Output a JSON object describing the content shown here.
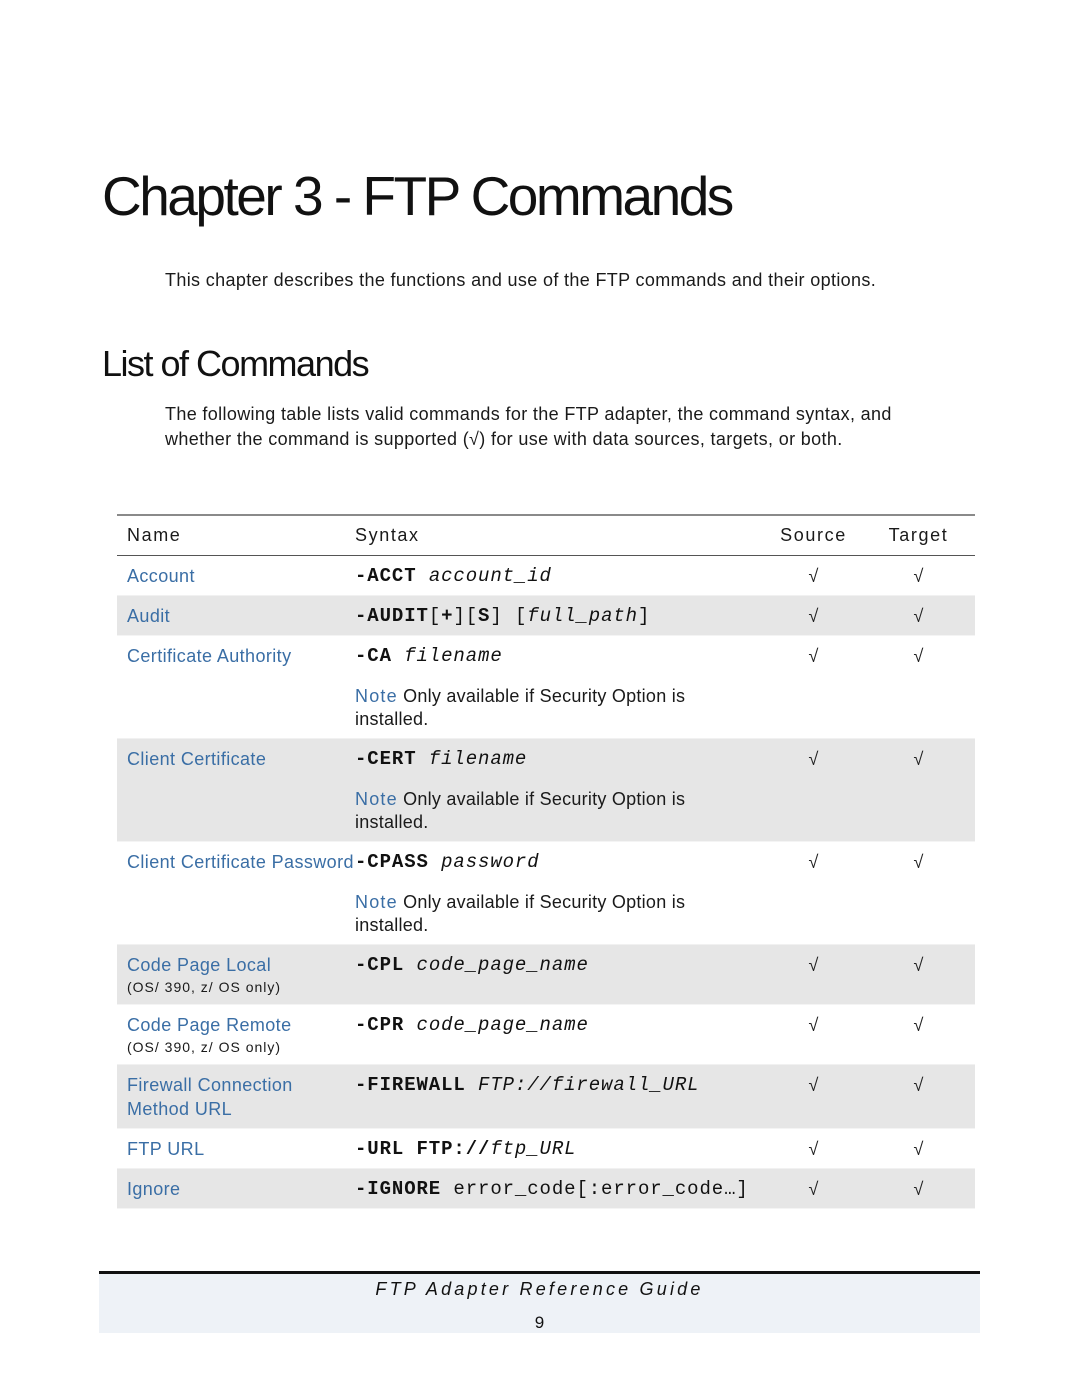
{
  "chapter_title": "Chapter 3 - FTP Commands",
  "intro": "This chapter describes the functions and use of the FTP commands and their options.",
  "section_title": "List of Commands",
  "section_intro": "The following table lists valid commands for the FTP adapter, the command syntax, and whether the command is supported (√) for use with data sources, targets, or both.",
  "table": {
    "headers": {
      "name": "Name",
      "syntax": "Syntax",
      "source": "Source",
      "target": "Target"
    },
    "rows": [
      {
        "name": "Account",
        "sub": "",
        "shaded": false,
        "syntax": [
          {
            "text": "-ACCT",
            "style": "b"
          },
          {
            "text": " account_id",
            "style": "i"
          }
        ],
        "note_label": "",
        "note": "",
        "source": "√",
        "target": "√"
      },
      {
        "name": "Audit",
        "sub": "",
        "shaded": true,
        "syntax": [
          {
            "text": "-AUDIT",
            "style": "b"
          },
          {
            "text": "[",
            "style": "n"
          },
          {
            "text": "+",
            "style": "b"
          },
          {
            "text": "][",
            "style": "n"
          },
          {
            "text": "S",
            "style": "b"
          },
          {
            "text": "] [",
            "style": "n"
          },
          {
            "text": "full_path",
            "style": "i"
          },
          {
            "text": "]",
            "style": "n"
          }
        ],
        "note_label": "",
        "note": "",
        "source": "√",
        "target": "√"
      },
      {
        "name": "Certificate Authority",
        "sub": "",
        "shaded": false,
        "syntax": [
          {
            "text": "-CA",
            "style": "b"
          },
          {
            "text": " filename",
            "style": "i"
          }
        ],
        "note_label": "Note",
        "note": " Only available if Security Option is installed.",
        "source": "√",
        "target": "√"
      },
      {
        "name": "Client Certificate",
        "sub": "",
        "shaded": true,
        "syntax": [
          {
            "text": "-CERT",
            "style": "b"
          },
          {
            "text": " filename",
            "style": "i"
          }
        ],
        "note_label": "Note",
        "note": " Only available if Security Option is installed.",
        "source": "√",
        "target": "√"
      },
      {
        "name": "Client Certificate Password",
        "sub": "",
        "shaded": false,
        "syntax": [
          {
            "text": "-CPASS",
            "style": "b"
          },
          {
            "text": " password",
            "style": "i"
          }
        ],
        "note_label": "Note",
        "note": " Only available if Security Option is installed.",
        "source": "√",
        "target": "√"
      },
      {
        "name": "Code Page Local",
        "sub": "(OS/ 390, z/ OS only)",
        "shaded": true,
        "syntax": [
          {
            "text": "-CPL",
            "style": "b"
          },
          {
            "text": " code_page_name",
            "style": "i"
          }
        ],
        "note_label": "",
        "note": "",
        "source": "√",
        "target": "√"
      },
      {
        "name": "Code Page Remote",
        "sub": "(OS/ 390, z/ OS only)",
        "shaded": false,
        "syntax": [
          {
            "text": "-CPR",
            "style": "b"
          },
          {
            "text": " code_page_name",
            "style": "i"
          }
        ],
        "note_label": "",
        "note": "",
        "source": "√",
        "target": "√"
      },
      {
        "name": "Firewall Connection Method URL",
        "sub": "",
        "shaded": true,
        "syntax": [
          {
            "text": "-FIREWALL",
            "style": "b"
          },
          {
            "text": " FTP://firewall_URL",
            "style": "i"
          }
        ],
        "note_label": "",
        "note": "",
        "source": "√",
        "target": "√"
      },
      {
        "name": "FTP URL",
        "sub": "",
        "shaded": false,
        "syntax": [
          {
            "text": "-URL FTP://",
            "style": "b"
          },
          {
            "text": "ftp_URL",
            "style": "i"
          }
        ],
        "note_label": "",
        "note": "",
        "source": "√",
        "target": "√"
      },
      {
        "name": "Ignore",
        "sub": "",
        "shaded": true,
        "syntax": [
          {
            "text": "-IGNORE",
            "style": "b"
          },
          {
            "text": " error_code[:error_code…]",
            "style": "n"
          }
        ],
        "note_label": "",
        "note": "",
        "source": "√",
        "target": "√"
      }
    ]
  },
  "colors": {
    "link": "#3a6ea5",
    "row_shade": "#e6e6e6",
    "footer_bg": "#eef2f7"
  },
  "footer": {
    "title": "FTP Adapter Reference Guide",
    "page": "9"
  }
}
